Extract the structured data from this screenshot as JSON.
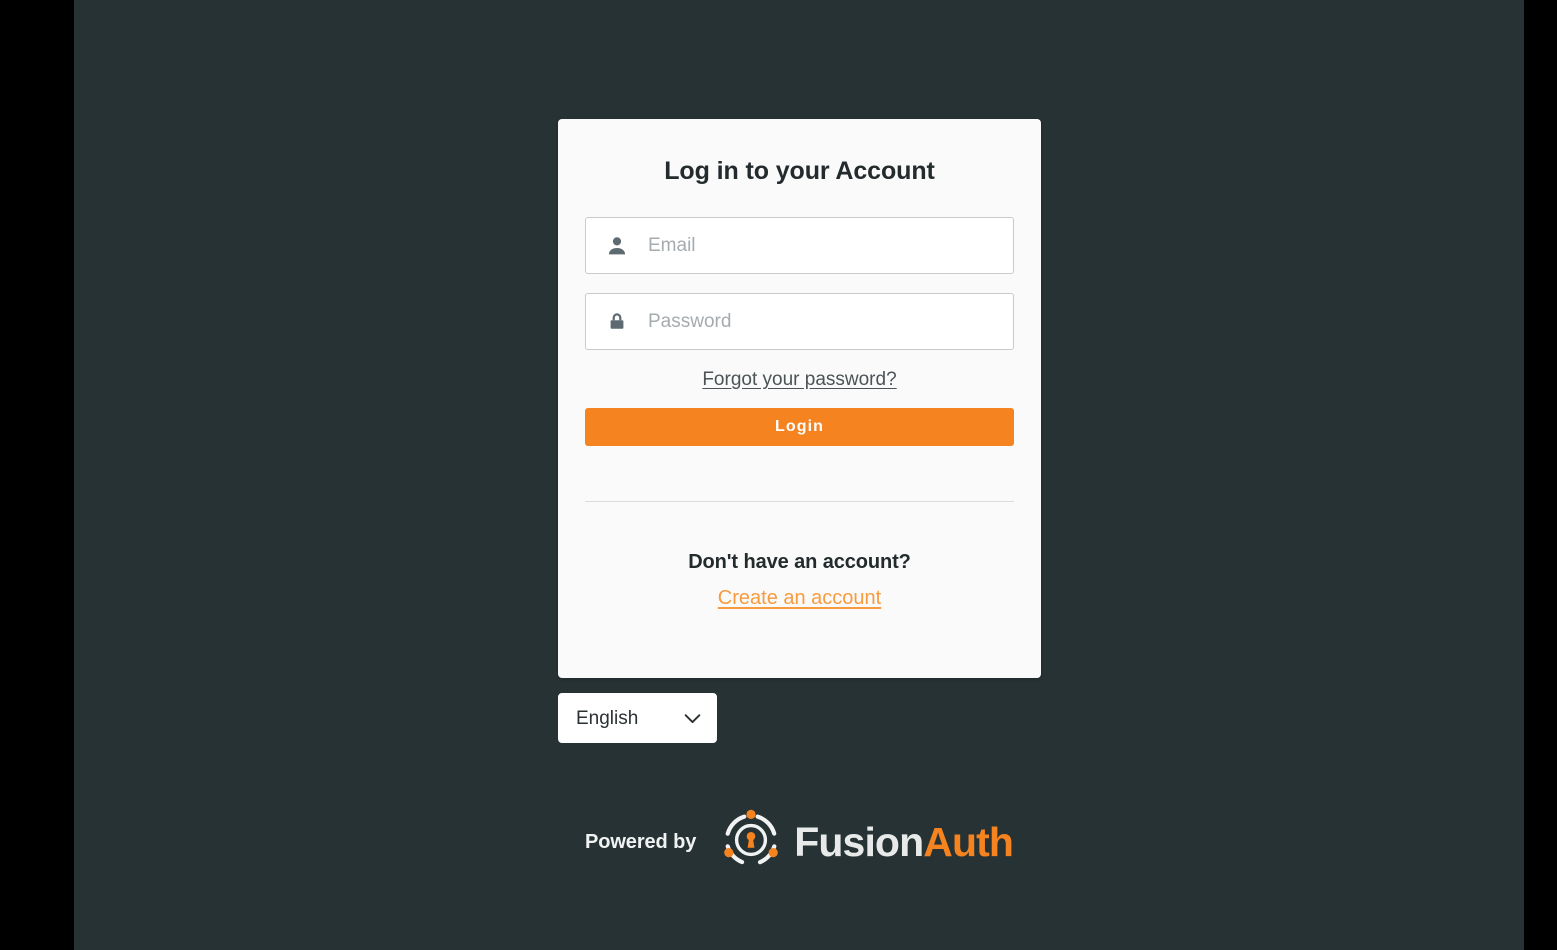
{
  "page": {
    "background_color": "#263233",
    "letterbox_color": "#000000"
  },
  "card": {
    "title": "Log in to your Account",
    "background_color": "#FAFAFA"
  },
  "form": {
    "email": {
      "placeholder": "Email",
      "value": "",
      "icon": "user-icon"
    },
    "password": {
      "placeholder": "Password",
      "value": "",
      "icon": "lock-icon"
    },
    "forgot_password_label": "Forgot your password?",
    "submit_label": "Login",
    "submit_color": "#F58320"
  },
  "signup": {
    "prompt": "Don't have an account?",
    "link_label": "Create an account",
    "link_color": "#F89B3E"
  },
  "locale": {
    "selected": "English",
    "options": [
      "English"
    ],
    "chevron_icon": "chevron-down-icon"
  },
  "footer": {
    "powered_by_label": "Powered by",
    "brand_first": "Fusion",
    "brand_second": "Auth",
    "brand_icon": "fusionauth-logo-icon",
    "brand_accent_color": "#F58320"
  }
}
